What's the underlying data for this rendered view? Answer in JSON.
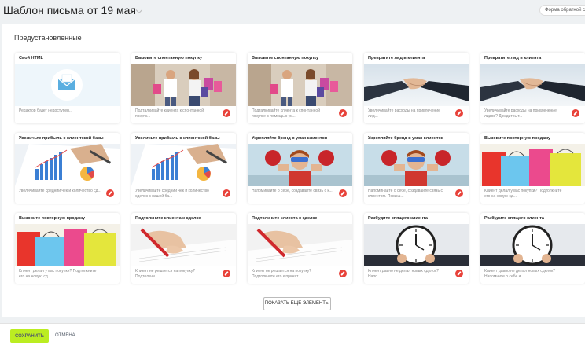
{
  "header": {
    "title": "Шаблон письма от 19 мая",
    "form_badge": "Форма обратной связ"
  },
  "section": {
    "title": "Предустановленные"
  },
  "cards": [
    {
      "title": "Свой HTML",
      "desc": "Редактор будет недоступен...",
      "image": "html-envelope",
      "editable": false
    },
    {
      "title": "Вызовите спонтанную покупку",
      "desc": "Подталкивайте клиента к спонтанной покупк...",
      "image": "shopping",
      "editable": true
    },
    {
      "title": "Вызовите спонтанную покупку",
      "desc": "Подталкивайте клиента к спонтанной покупке с помощью ук...",
      "image": "shopping",
      "editable": true
    },
    {
      "title": "Превратите лид в клиента",
      "desc": "Увеличивайте расходы на привлечение лид...",
      "image": "handshake",
      "editable": true
    },
    {
      "title": "Превратите лид в клиента",
      "desc": "Увеличивайте расходы на привлечение лидов? Дождитеь т...",
      "image": "handshake",
      "editable": true
    },
    {
      "title": "Увеличьте прибыль с клиентской базы",
      "desc": "Увеличивайте средний чек и количество сд...",
      "image": "charts",
      "editable": true
    },
    {
      "title": "Увеличьте прибыль с клиентской базы",
      "desc": "Увеличивайте средний чек и количество сделок с вашей ба...",
      "image": "charts",
      "editable": true
    },
    {
      "title": "Укрепляйте бренд в умах клиентов",
      "desc": "Напоминайте о себе, создавайте связь с к...",
      "image": "boxer",
      "editable": true
    },
    {
      "title": "Укрепляйте бренд в умах клиентов",
      "desc": "Напоминайте о себе, создавайте связь с клиентом. Повыш...",
      "image": "boxer",
      "editable": true
    },
    {
      "title": "Вызовите повторную продажу",
      "desc": "Клиент делал у вас покупки? Подтолкните его на новую сд...",
      "image": "bags",
      "editable": false
    },
    {
      "title": "Вызовите повторную продажу",
      "desc": "Клиент делал у вас покупки? Подтолкните его на новую сд...",
      "image": "bags",
      "editable": false
    },
    {
      "title": "Подтолкните клиента к сделке",
      "desc": "Клиент не решается на покупку? Подтолкни...",
      "image": "pen",
      "editable": true
    },
    {
      "title": "Подтолкните клиента к сделке",
      "desc": "Клиент не решается на покупку? Подтолкните его к принят...",
      "image": "pen",
      "editable": true
    },
    {
      "title": "Разбудите спящего клиента",
      "desc": "Клиент давно не делал новых сделок? Напо...",
      "image": "clock",
      "editable": true
    },
    {
      "title": "Разбудите спящего клиента",
      "desc": "Клиент давно не делал новых сделок? Напомните о себе и ...",
      "image": "clock",
      "editable": false
    }
  ],
  "show_more_label": "ПОКАЗАТЬ ЕЩЕ ЭЛЕМЕНТЫ",
  "footer": {
    "save_label": "СОХРАНИТЬ",
    "cancel_label": "ОТМЕНА"
  },
  "colors": {
    "accent_green": "#bbed21",
    "edit_red": "#e8423a",
    "background": "#eef1f3"
  }
}
